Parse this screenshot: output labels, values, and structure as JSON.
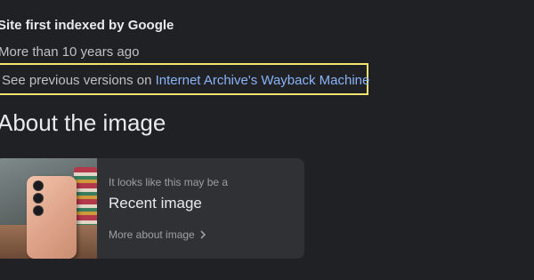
{
  "site_info": {
    "heading": "Site first indexed by Google",
    "age": "More than 10 years ago",
    "previous_versions_prefix": "See previous versions on ",
    "wayback_link": "Internet Archive's Wayback Machine"
  },
  "about_image": {
    "title": "About the image",
    "card": {
      "kicker": "It looks like this may be a",
      "title": "Recent image",
      "more_label": "More about image",
      "chevron_icon": "chevron-right-icon"
    }
  },
  "colors": {
    "background": "#202124",
    "card_background": "#303134",
    "link": "#8ab4f8",
    "highlight_border": "#f2e46e"
  }
}
